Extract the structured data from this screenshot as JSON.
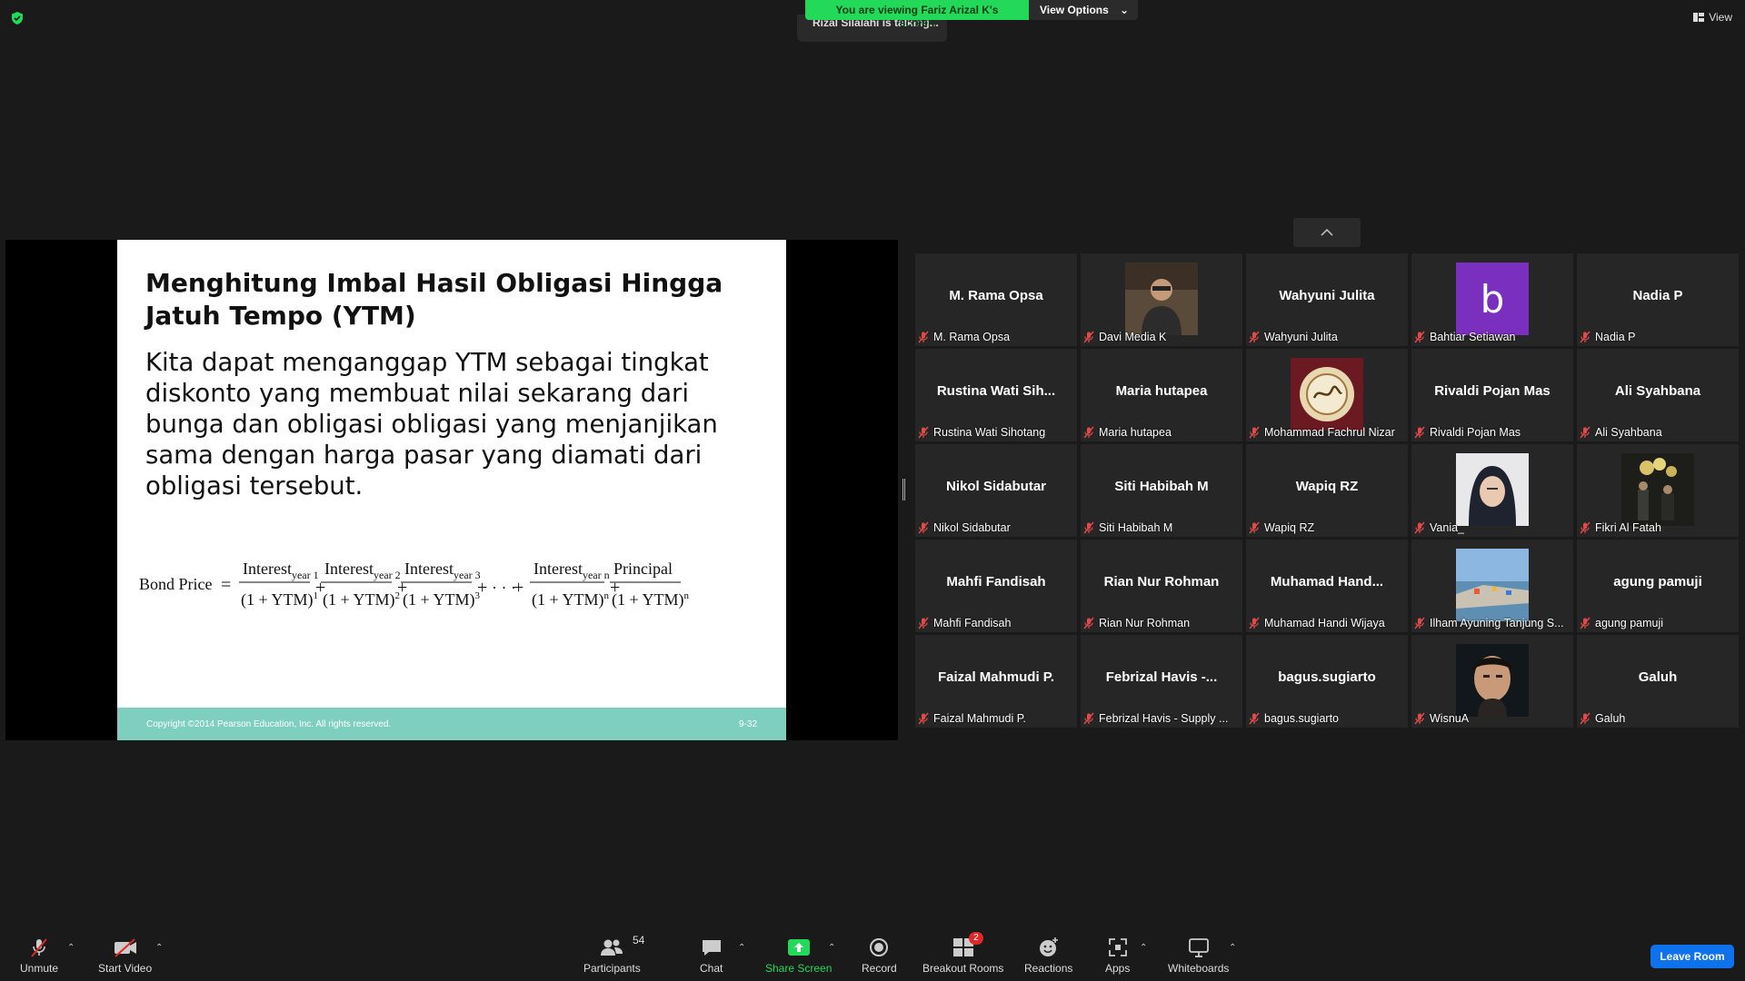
{
  "top": {
    "banner_text": "You are viewing Fariz Arizal K's screen",
    "view_options": "View Options",
    "talking": "Rizal Silalahi is talking...",
    "view_label": "View"
  },
  "slide": {
    "title": "Menghitung Imbal Hasil Obligasi Hingga Jatuh Tempo (YTM)",
    "body": "Kita dapat menganggap YTM sebagai tingkat diskonto yang membuat nilai sekarang dari bunga dan obligasi obligasi yang menjanjikan sama dengan harga pasar yang diamati dari obligasi tersebut.",
    "formula": {
      "lhs": "Bond Price",
      "terms": [
        {
          "num": "Interest",
          "sub": "year 1",
          "den": "(1 + YTM)",
          "exp": "1"
        },
        {
          "num": "Interest",
          "sub": "year 2",
          "den": "(1 + YTM)",
          "exp": "2"
        },
        {
          "num": "Interest",
          "sub": "year 3",
          "den": "(1 + YTM)",
          "exp": "3"
        },
        {
          "num": "Interest",
          "sub": "year n",
          "den": "(1 + YTM)",
          "exp": "n"
        },
        {
          "num": "Principal",
          "sub": "",
          "den": "(1 + YTM)",
          "exp": "n"
        }
      ],
      "ellipsis": "· · ·"
    },
    "copyright": "Copyright ©2014 Pearson Education, Inc. All rights reserved.",
    "page": "9-32"
  },
  "participants": [
    {
      "big": "M. Rama Opsa",
      "name": "M. Rama Opsa",
      "photo": ""
    },
    {
      "big": "",
      "name": "Davi Media K",
      "photo": "man-photo"
    },
    {
      "big": "Wahyuni Julita",
      "name": "Wahyuni Julita",
      "photo": ""
    },
    {
      "big": "",
      "name": "Bahtiar Setiawan",
      "photo": "letter-b"
    },
    {
      "big": "Nadia P",
      "name": "Nadia P",
      "photo": ""
    },
    {
      "big": "Rustina  Wati  Sih...",
      "name": "Rustina Wati Sihotang",
      "photo": ""
    },
    {
      "big": "Maria hutapea",
      "name": "Maria hutapea",
      "photo": ""
    },
    {
      "big": "",
      "name": "Mohammad Fachrul Nizar",
      "photo": "calligraphy"
    },
    {
      "big": "Rivaldi Pojan Mas",
      "name": "Rivaldi Pojan Mas",
      "photo": ""
    },
    {
      "big": "Ali Syahbana",
      "name": "Ali Syahbana",
      "photo": ""
    },
    {
      "big": "Nikol Sidabutar",
      "name": "Nikol Sidabutar",
      "photo": ""
    },
    {
      "big": "Siti Habibah M",
      "name": "Siti Habibah M",
      "photo": ""
    },
    {
      "big": "Wapiq RZ",
      "name": "Wapiq RZ",
      "photo": ""
    },
    {
      "big": "",
      "name": "Vania_",
      "photo": "hijab-photo"
    },
    {
      "big": "",
      "name": "Fikri Al Fatah",
      "photo": "party-photo"
    },
    {
      "big": "Mahfi Fandisah",
      "name": "Mahfi Fandisah",
      "photo": ""
    },
    {
      "big": "Rian Nur Rohman",
      "name": "Rian Nur Rohman",
      "photo": ""
    },
    {
      "big": "Muhamad  Hand...",
      "name": "Muhamad Handi Wijaya",
      "photo": ""
    },
    {
      "big": "",
      "name": "Ilham Ayuning Tanjung S...",
      "photo": "harbor-photo"
    },
    {
      "big": "agung pamuji",
      "name": "agung pamuji",
      "photo": ""
    },
    {
      "big": "Faizal Mahmudi P.",
      "name": "Faizal Mahmudi P.",
      "photo": ""
    },
    {
      "big": "Febrizal  Havis  -...",
      "name": "Febrizal Havis - Supply ...",
      "photo": ""
    },
    {
      "big": "bagus.sugiarto",
      "name": "bagus.sugiarto",
      "photo": ""
    },
    {
      "big": "",
      "name": "WisnuA",
      "photo": "portrait-photo"
    },
    {
      "big": "Galuh",
      "name": "Galuh",
      "photo": ""
    }
  ],
  "toolbar": {
    "unmute": "Unmute",
    "start_video": "Start Video",
    "participants": "Participants",
    "participant_count": "54",
    "chat": "Chat",
    "share_screen": "Share Screen",
    "record": "Record",
    "breakout_rooms": "Breakout Rooms",
    "breakout_badge": "2",
    "reactions": "Reactions",
    "apps": "Apps",
    "whiteboards": "Whiteboards",
    "leave": "Leave Room"
  },
  "colors": {
    "accent_green": "#23d959",
    "leave_blue": "#0e72ed",
    "slide_footer": "#7ecfc0",
    "muted_red": "#e02828"
  }
}
